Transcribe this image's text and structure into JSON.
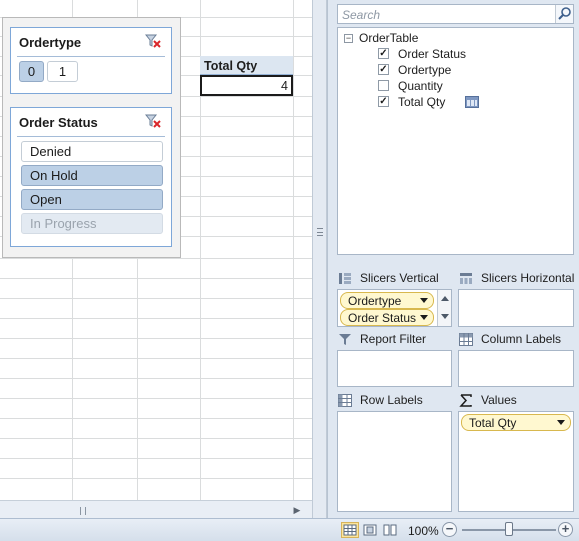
{
  "slicers": {
    "ordertype": {
      "title": "Ordertype",
      "items": [
        "0",
        "1"
      ]
    },
    "order_status": {
      "title": "Order Status",
      "items": [
        "Denied",
        "On Hold",
        "Open",
        "In Progress"
      ]
    }
  },
  "pivot": {
    "header": "Total Qty",
    "value": "4"
  },
  "field_list": {
    "search_placeholder": "Search",
    "table_name": "OrderTable",
    "fields": [
      {
        "label": "Order Status",
        "checked": true
      },
      {
        "label": "Ordertype",
        "checked": true
      },
      {
        "label": "Quantity",
        "checked": false
      },
      {
        "label": "Total Qty",
        "checked": true
      }
    ],
    "areas": {
      "slicers_vertical": {
        "label": "Slicers Vertical",
        "chips": [
          "Ordertype",
          "Order Status"
        ]
      },
      "slicers_horizontal": {
        "label": "Slicers Horizontal"
      },
      "report_filter": {
        "label": "Report Filter"
      },
      "column_labels": {
        "label": "Column Labels"
      },
      "row_labels": {
        "label": "Row Labels"
      },
      "values": {
        "label": "Values",
        "chips": [
          "Total Qty"
        ]
      }
    }
  },
  "statusbar": {
    "zoom_level": "100%",
    "zoom_out": "−",
    "zoom_in": "+"
  },
  "colors": {
    "slicer_selected": "#bcd0e6",
    "slicer_border": "#7ea7d8",
    "chip_fill": "#fff8d0",
    "pane_background": "#dfe7f1"
  }
}
